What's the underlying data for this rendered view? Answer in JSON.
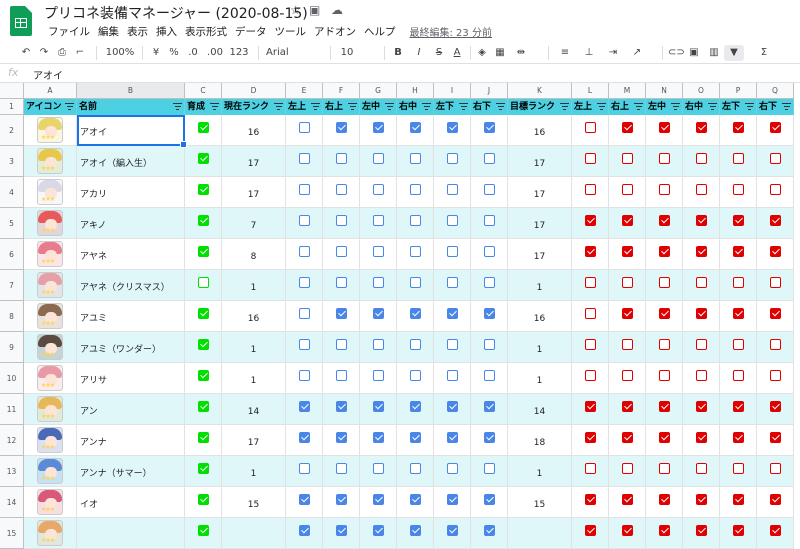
{
  "app": {
    "title": "プリコネ装備マネージャー (2020-08-15)",
    "menu": [
      "ファイル",
      "編集",
      "表示",
      "挿入",
      "表示形式",
      "データ",
      "ツール",
      "アドオン",
      "ヘルプ"
    ],
    "last_edit": "最終編集: 23 分前"
  },
  "toolbar": {
    "zoom": "100%",
    "currency": "¥",
    "percent": "%",
    "dec_less": ".0",
    "dec_more": ".00",
    "format": "123",
    "font": "Arial",
    "font_size": "10",
    "bold": "B",
    "italic": "I",
    "strike": "S",
    "text_color": "A",
    "sum": "Σ"
  },
  "formula": {
    "fx": "fx",
    "value": "アオイ"
  },
  "colors": {
    "header_bg": "#4dd0e1",
    "band": "#e0f7fa",
    "blue_check": "#4a86e8",
    "red_check": "#e00000",
    "green_check": "#00e000"
  },
  "columns": [
    "A",
    "B",
    "C",
    "D",
    "E",
    "F",
    "G",
    "H",
    "I",
    "J",
    "K",
    "L",
    "M",
    "N",
    "O",
    "P",
    "Q"
  ],
  "headers": [
    "アイコン",
    "名前",
    "育成",
    "現在ランク",
    "左上",
    "右上",
    "左中",
    "右中",
    "左下",
    "右下",
    "目標ランク",
    "左上",
    "右上",
    "左中",
    "右中",
    "左下",
    "右下"
  ],
  "rows": [
    {
      "num": "2",
      "name": "アオイ",
      "grow": true,
      "rank": "16",
      "cur": [
        0,
        1,
        1,
        1,
        1,
        1
      ],
      "target": "16",
      "tgt": [
        0,
        1,
        1,
        1,
        1,
        1
      ],
      "avatar": "#e8d46a"
    },
    {
      "num": "3",
      "name": "アオイ（編入生）",
      "grow": true,
      "rank": "17",
      "cur": [
        0,
        0,
        0,
        0,
        0,
        0
      ],
      "target": "17",
      "tgt": [
        0,
        0,
        0,
        0,
        0,
        0
      ],
      "avatar": "#e6c84a"
    },
    {
      "num": "4",
      "name": "アカリ",
      "grow": true,
      "rank": "17",
      "cur": [
        0,
        0,
        0,
        0,
        0,
        0
      ],
      "target": "17",
      "tgt": [
        0,
        0,
        0,
        0,
        0,
        0
      ],
      "avatar": "#d8d8e6"
    },
    {
      "num": "5",
      "name": "アキノ",
      "grow": true,
      "rank": "7",
      "cur": [
        0,
        0,
        0,
        0,
        0,
        0
      ],
      "target": "17",
      "tgt": [
        1,
        1,
        1,
        1,
        1,
        1
      ],
      "avatar": "#e85a5a"
    },
    {
      "num": "6",
      "name": "アヤネ",
      "grow": true,
      "rank": "8",
      "cur": [
        0,
        0,
        0,
        0,
        0,
        0
      ],
      "target": "17",
      "tgt": [
        1,
        1,
        1,
        1,
        1,
        1
      ],
      "avatar": "#e87b8c"
    },
    {
      "num": "7",
      "name": "アヤネ（クリスマス）",
      "grow": false,
      "rank": "1",
      "cur": [
        0,
        0,
        0,
        0,
        0,
        0
      ],
      "target": "1",
      "tgt": [
        0,
        0,
        0,
        0,
        0,
        0
      ],
      "avatar": "#e6a0a8"
    },
    {
      "num": "8",
      "name": "アユミ",
      "grow": true,
      "rank": "16",
      "cur": [
        0,
        1,
        1,
        1,
        1,
        1
      ],
      "target": "16",
      "tgt": [
        0,
        1,
        1,
        1,
        1,
        1
      ],
      "avatar": "#8a6a50"
    },
    {
      "num": "9",
      "name": "アユミ（ワンダー）",
      "grow": true,
      "rank": "1",
      "cur": [
        0,
        0,
        0,
        0,
        0,
        0
      ],
      "target": "1",
      "tgt": [
        0,
        0,
        0,
        0,
        0,
        0
      ],
      "avatar": "#5a4a40"
    },
    {
      "num": "10",
      "name": "アリサ",
      "grow": true,
      "rank": "1",
      "cur": [
        0,
        0,
        0,
        0,
        0,
        0
      ],
      "target": "1",
      "tgt": [
        0,
        0,
        0,
        0,
        0,
        0
      ],
      "avatar": "#e89aa6"
    },
    {
      "num": "11",
      "name": "アン",
      "grow": true,
      "rank": "14",
      "cur": [
        1,
        1,
        1,
        1,
        1,
        1
      ],
      "target": "14",
      "tgt": [
        1,
        1,
        1,
        1,
        1,
        1
      ],
      "avatar": "#e6b85a"
    },
    {
      "num": "12",
      "name": "アンナ",
      "grow": true,
      "rank": "17",
      "cur": [
        1,
        1,
        1,
        1,
        1,
        1
      ],
      "target": "18",
      "tgt": [
        1,
        1,
        1,
        1,
        1,
        1
      ],
      "avatar": "#4a6ab8"
    },
    {
      "num": "13",
      "name": "アンナ（サマー）",
      "grow": true,
      "rank": "1",
      "cur": [
        0,
        0,
        0,
        0,
        0,
        0
      ],
      "target": "1",
      "tgt": [
        0,
        0,
        0,
        0,
        0,
        0
      ],
      "avatar": "#5a8ad8"
    },
    {
      "num": "14",
      "name": "イオ",
      "grow": true,
      "rank": "15",
      "cur": [
        1,
        1,
        1,
        1,
        1,
        1
      ],
      "target": "15",
      "tgt": [
        1,
        1,
        1,
        1,
        1,
        1
      ],
      "avatar": "#d85a7a"
    },
    {
      "num": "15",
      "name": "",
      "grow": true,
      "rank": "",
      "cur": [
        1,
        1,
        1,
        1,
        1,
        1
      ],
      "target": "",
      "tgt": [
        1,
        1,
        1,
        1,
        1,
        1
      ],
      "avatar": "#e8a86a"
    }
  ]
}
